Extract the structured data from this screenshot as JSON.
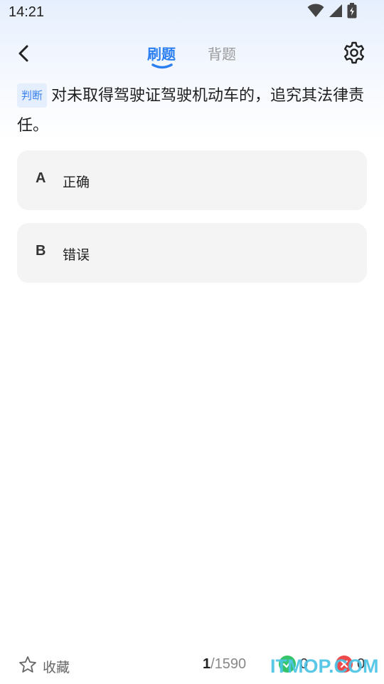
{
  "status_bar": {
    "time": "14:21",
    "icons": [
      "wifi-icon",
      "signal-icon",
      "battery-charging-icon"
    ]
  },
  "nav": {
    "back_icon": "chevron-left-icon",
    "tabs": [
      {
        "label": "刷题",
        "active": true
      },
      {
        "label": "背题",
        "active": false
      }
    ],
    "settings_icon": "gear-icon",
    "accent_color": "#2a7ef0"
  },
  "question": {
    "type_badge": "判断",
    "text": "对未取得驾驶证驾驶机动车的，追究其法律责任。"
  },
  "options": [
    {
      "letter": "A",
      "text": "正确"
    },
    {
      "letter": "B",
      "text": "错误"
    }
  ],
  "bottom_bar": {
    "favorite_label": "收藏",
    "current": "1",
    "separator": "/",
    "total": "1590",
    "correct_count": "0",
    "wrong_count": "0"
  },
  "watermark": "ITMOP.COM"
}
